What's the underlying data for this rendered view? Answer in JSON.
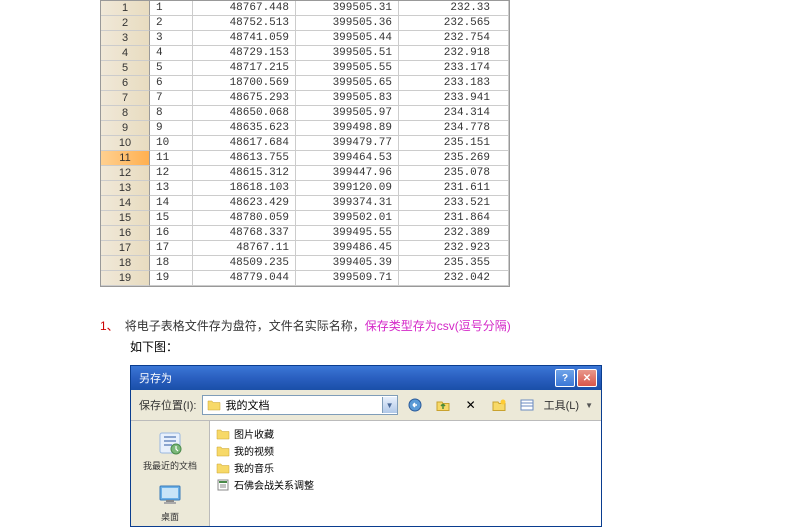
{
  "spreadsheet": {
    "selected_row": 11,
    "rows": [
      {
        "n": 1,
        "id": "1",
        "a": "48767.448",
        "b": "399505.31",
        "c": "232.33"
      },
      {
        "n": 2,
        "id": "2",
        "a": "48752.513",
        "b": "399505.36",
        "c": "232.565"
      },
      {
        "n": 3,
        "id": "3",
        "a": "48741.059",
        "b": "399505.44",
        "c": "232.754"
      },
      {
        "n": 4,
        "id": "4",
        "a": "48729.153",
        "b": "399505.51",
        "c": "232.918"
      },
      {
        "n": 5,
        "id": "5",
        "a": "48717.215",
        "b": "399505.55",
        "c": "233.174"
      },
      {
        "n": 6,
        "id": "6",
        "a": "18700.569",
        "b": "399505.65",
        "c": "233.183"
      },
      {
        "n": 7,
        "id": "7",
        "a": "48675.293",
        "b": "399505.83",
        "c": "233.941"
      },
      {
        "n": 8,
        "id": "8",
        "a": "48650.068",
        "b": "399505.97",
        "c": "234.314"
      },
      {
        "n": 9,
        "id": "9",
        "a": "48635.623",
        "b": "399498.89",
        "c": "234.778"
      },
      {
        "n": 10,
        "id": "10",
        "a": "48617.684",
        "b": "399479.77",
        "c": "235.151"
      },
      {
        "n": 11,
        "id": "11",
        "a": "48613.755",
        "b": "399464.53",
        "c": "235.269"
      },
      {
        "n": 12,
        "id": "12",
        "a": "48615.312",
        "b": "399447.96",
        "c": "235.078"
      },
      {
        "n": 13,
        "id": "13",
        "a": "18618.103",
        "b": "399120.09",
        "c": "231.611"
      },
      {
        "n": 14,
        "id": "14",
        "a": "48623.429",
        "b": "399374.31",
        "c": "233.521"
      },
      {
        "n": 15,
        "id": "15",
        "a": "48780.059",
        "b": "399502.01",
        "c": "231.864"
      },
      {
        "n": 16,
        "id": "16",
        "a": "48768.337",
        "b": "399495.55",
        "c": "232.389"
      },
      {
        "n": 17,
        "id": "17",
        "a": "48767.11",
        "b": "399486.45",
        "c": "232.923"
      },
      {
        "n": 18,
        "id": "18",
        "a": "48509.235",
        "b": "399405.39",
        "c": "235.355"
      },
      {
        "n": 19,
        "id": "19",
        "a": "48779.044",
        "b": "399509.71",
        "c": "232.042"
      }
    ]
  },
  "instruction": {
    "num": "1、",
    "text_a": "将电子表格文件存为盘符，文件名实际名称，",
    "highlight": "保存类型存为csv(逗号分隔)",
    "text_b": "如下图："
  },
  "dialog": {
    "title": "另存为",
    "location_label": "保存位置(I):",
    "path": "我的文档",
    "tools_label": "工具(L)",
    "sidebar": [
      {
        "icon": "recent",
        "label": "我最近的文档"
      },
      {
        "icon": "desktop",
        "label": "桌面"
      }
    ],
    "files": [
      {
        "icon": "folder",
        "name": "图片收藏"
      },
      {
        "icon": "folder",
        "name": "我的视频"
      },
      {
        "icon": "folder",
        "name": "我的音乐"
      },
      {
        "icon": "file",
        "name": "石佛会战关系调整"
      }
    ]
  }
}
